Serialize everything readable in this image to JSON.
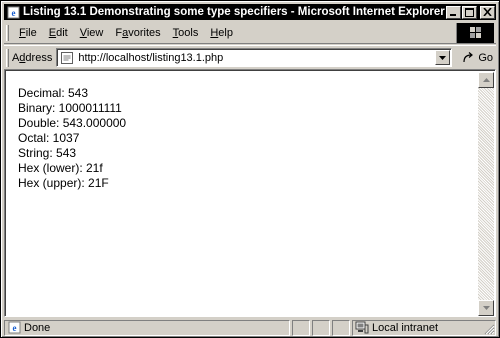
{
  "window": {
    "title": "Listing 13.1 Demonstrating some type specifiers - Microsoft Internet Explorer",
    "icons": {
      "app": "ie-page-icon",
      "minimize": "minimize-icon",
      "maximize": "maximize-icon",
      "close": "close-icon"
    }
  },
  "menu": {
    "items": [
      {
        "key": "F",
        "rest": "ile"
      },
      {
        "key": "E",
        "rest": "dit"
      },
      {
        "key": "V",
        "rest": "iew"
      },
      {
        "pre": "F",
        "key": "a",
        "rest": "vorites"
      },
      {
        "key": "T",
        "rest": "ools"
      },
      {
        "key": "H",
        "rest": "elp"
      }
    ]
  },
  "address": {
    "label_pre": "A",
    "label_key": "d",
    "label_rest": "dress",
    "url": "http://localhost/listing13.1.php",
    "go_label": "Go"
  },
  "content": {
    "lines": [
      "Decimal: 543",
      "Binary: 1000011111",
      "Double: 543.000000",
      "Octal: 1037",
      "String: 543",
      "Hex (lower): 21f",
      "Hex (upper): 21F"
    ]
  },
  "status": {
    "text": "Done",
    "zone": "Local intranet"
  }
}
